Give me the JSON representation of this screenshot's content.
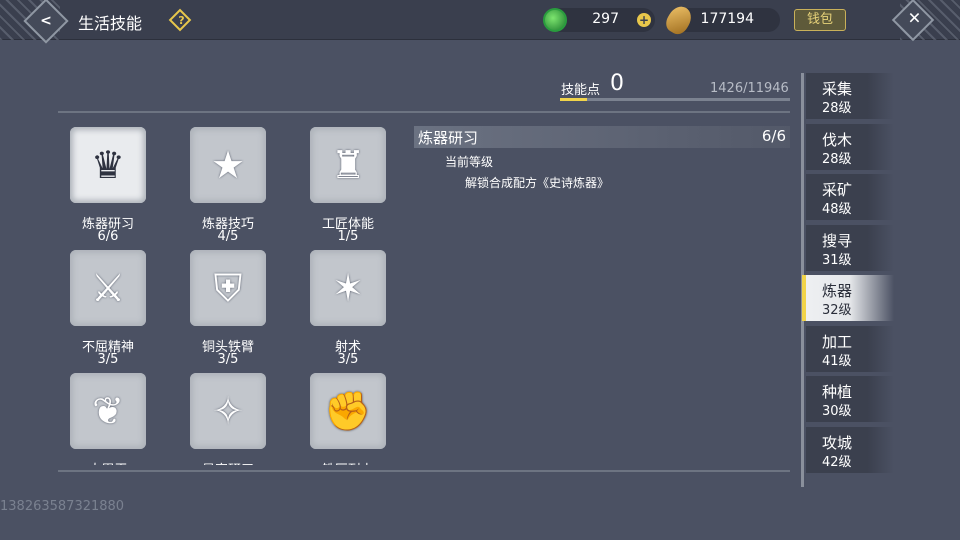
{
  "header": {
    "title": "生活技能",
    "help_label": "?",
    "back_label": "<",
    "close_label": "✕",
    "jade_amount": "297",
    "gold_amount": "177194",
    "plus_label": "+",
    "wallet_label": "钱包"
  },
  "skill_points": {
    "label": "技能点",
    "value": "0",
    "progress_text": "1426/11946",
    "progress_fraction": 0.119
  },
  "skills": [
    {
      "name": "炼器研习",
      "level": "6/6",
      "icon": "trophy-banner-icon",
      "selected": true
    },
    {
      "name": "炼器技巧",
      "level": "4/5",
      "icon": "star-banner-icon",
      "selected": false
    },
    {
      "name": "工匠体能",
      "level": "1/5",
      "icon": "muscle-torso-icon",
      "selected": false
    },
    {
      "name": "不屈精神",
      "level": "3/5",
      "icon": "sword-shield-icon",
      "selected": false
    },
    {
      "name": "铜头铁臂",
      "level": "3/5",
      "icon": "armor-icon",
      "selected": false
    },
    {
      "name": "射术",
      "level": "3/5",
      "icon": "archer-icon",
      "selected": false
    },
    {
      "name": "大胃王",
      "level": "",
      "icon": "stomach-icon",
      "selected": false
    },
    {
      "name": "星宿研习",
      "level": "",
      "icon": "constellation-icon",
      "selected": false
    },
    {
      "name": "铁匠耐力",
      "level": "",
      "icon": "flexed-arm-icon",
      "selected": false
    }
  ],
  "detail": {
    "name": "炼器研习",
    "level": "6/6",
    "subtitle": "当前等级",
    "description": "解锁合成配方《史诗炼器》"
  },
  "tabs": [
    {
      "name": "采集",
      "level": "28级",
      "active": false
    },
    {
      "name": "伐木",
      "level": "28级",
      "active": false
    },
    {
      "name": "采矿",
      "level": "48级",
      "active": false
    },
    {
      "name": "搜寻",
      "level": "31级",
      "active": false
    },
    {
      "name": "炼器",
      "level": "32级",
      "active": true
    },
    {
      "name": "加工",
      "level": "41级",
      "active": false
    },
    {
      "name": "种植",
      "level": "30级",
      "active": false
    },
    {
      "name": "攻城",
      "level": "42级",
      "active": false
    }
  ],
  "watermark": "138263587321880",
  "colors": {
    "background": "#4b5163",
    "accent_yellow": "#f1d44a",
    "tab_active": "#e5e7ea"
  }
}
